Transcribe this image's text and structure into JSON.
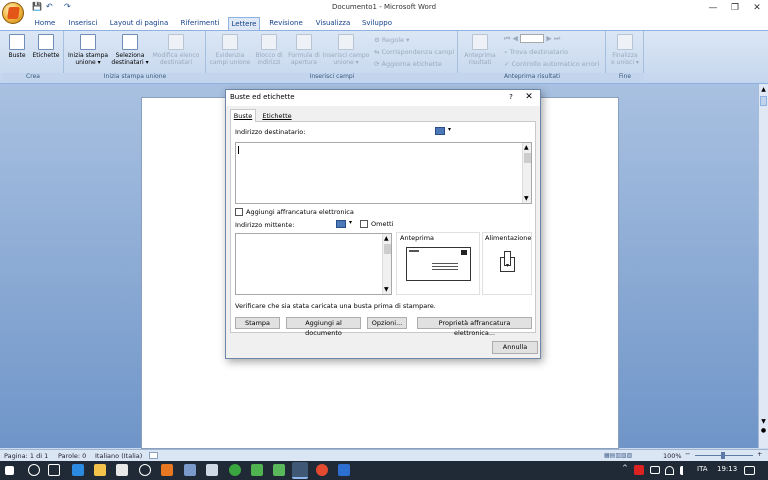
{
  "window": {
    "title": "Documento1 - Microsoft Word",
    "minimize": "—",
    "maximize": "❐",
    "close": "✕",
    "help": "?"
  },
  "qat": {
    "save": "💾",
    "undo": "↶",
    "redo": "↷"
  },
  "tabs": [
    "Home",
    "Inserisci",
    "Layout di pagina",
    "Riferimenti",
    "Lettere",
    "Revisione",
    "Visualizza",
    "Sviluppo"
  ],
  "active_tab": "Lettere",
  "ribbon": {
    "groups": {
      "crea": "Crea",
      "inizia": "Inizia stampa unione",
      "inserisci": "Inserisci campi",
      "anteprima": "Anteprima risultati",
      "fine": "Fine"
    },
    "buttons": {
      "buste": "Buste",
      "etichette": "Etichette",
      "inizia_stampa_1": "Inizia stampa",
      "inizia_stampa_2": "unione ▾",
      "seleziona_1": "Seleziona",
      "seleziona_2": "destinatari ▾",
      "modifica_1": "Modifica elenco",
      "modifica_2": "destinatari",
      "evidenzia_1": "Evidenzia",
      "evidenzia_2": "campi unione",
      "blocco_1": "Blocco di",
      "blocco_2": "indirizzi",
      "formula_1": "Formula di",
      "formula_2": "apertura",
      "inserisci_campo_1": "Inserisci campo",
      "inserisci_campo_2": "unione ▾",
      "regole": "Regole ▾",
      "corrispondenza": "Corrispondenza campi",
      "aggiorna": "Aggiorna etichette",
      "anteprima_1": "Anteprima",
      "anteprima_2": "risultati",
      "trova": "Trova destinatario",
      "controllo": "Controllo automatico errori",
      "finalizza_1": "Finalizza",
      "finalizza_2": "e unisci ▾"
    }
  },
  "dialog": {
    "title": "Buste ed etichette",
    "tab_buste": "Buste",
    "tab_etichette": "Etichette",
    "indirizzo_destinatario": "Indirizzo destinatario:",
    "aggiungi_affrancatura": "Aggiungi affrancatura elettronica",
    "indirizzo_mittente": "Indirizzo mittente:",
    "ometti": "Ometti",
    "anteprima": "Anteprima",
    "alimentazione": "Alimentazione",
    "verificare": "Verificare che sia stata caricata una busta prima di stampare.",
    "btn_stampa": "Stampa",
    "btn_aggiungi": "Aggiungi al documento",
    "btn_opzioni": "Opzioni...",
    "btn_proprieta": "Proprietà affrancatura elettronica...",
    "btn_annulla": "Annulla",
    "destinatario_value": "",
    "mittente_value": ""
  },
  "statusbar": {
    "pagina": "Pagina: 1 di 1",
    "parole": "Parole: 0",
    "lingua": "Italiano (Italia)",
    "zoom": "100%",
    "zoom_minus": "−",
    "zoom_plus": "+"
  },
  "taskbar": {
    "lang": "ITA",
    "time": "19:13"
  },
  "colors": {
    "ribbon_bg": "#c4d6ee",
    "tab_text": "#15428b",
    "taskbar": "#1f2a36"
  }
}
